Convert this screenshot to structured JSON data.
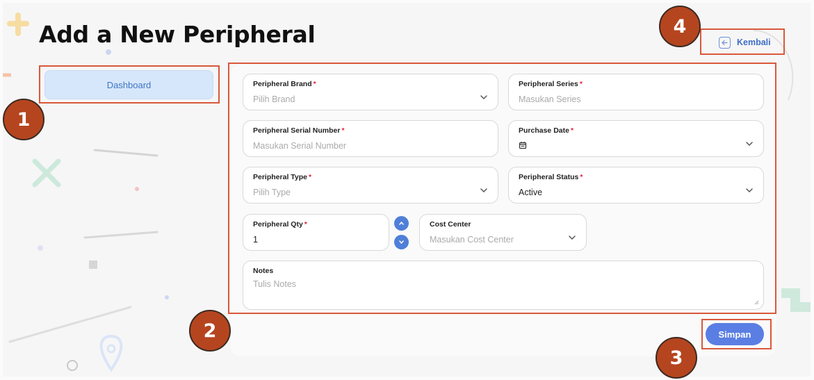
{
  "page": {
    "title": "Add a New Peripheral"
  },
  "nav": {
    "back_label": "Kembali",
    "back_icon": "arrow-left-icon"
  },
  "sidebar": {
    "items": [
      {
        "label": "Dashboard"
      }
    ]
  },
  "form": {
    "required_mark": "*",
    "brand": {
      "label": "Peripheral Brand",
      "placeholder": "Pilih Brand"
    },
    "series": {
      "label": "Peripheral Series",
      "placeholder": "Masukan Series"
    },
    "serial_number": {
      "label": "Peripheral Serial Number",
      "placeholder": "Masukan Serial Number"
    },
    "purchase_date": {
      "label": "Purchase Date",
      "icon": "calendar-icon"
    },
    "type": {
      "label": "Peripheral Type",
      "placeholder": "Pilih Type"
    },
    "status": {
      "label": "Peripheral Status",
      "value": "Active"
    },
    "qty": {
      "label": "Peripheral Qty",
      "value": "1"
    },
    "cost_center": {
      "label": "Cost Center",
      "placeholder": "Masukan Cost Center"
    },
    "notes": {
      "label": "Notes",
      "placeholder": "Tulis Notes"
    },
    "save_label": "Simpan"
  },
  "annotations": {
    "markers": [
      "1",
      "2",
      "3",
      "4"
    ]
  },
  "colors": {
    "accent": "#5a7ee3",
    "required": "#e0233a",
    "annotation_border": "#d9583b",
    "marker_fill": "#b5451f",
    "sidebar_active": "#d6e7fb"
  }
}
